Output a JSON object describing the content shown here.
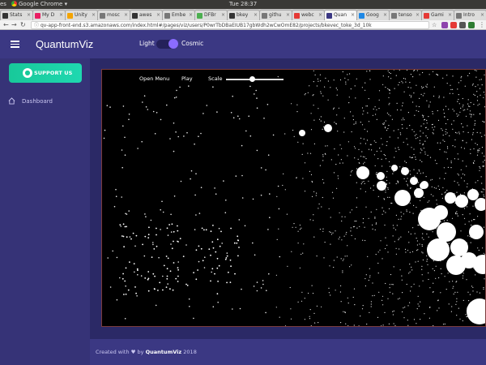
{
  "os": {
    "left_text": "es",
    "app_name": "Google Chrome",
    "clock": "Tue 28:37"
  },
  "tabs": [
    {
      "label": "Stats",
      "color": "#333"
    },
    {
      "label": "My D",
      "color": "#e91e63"
    },
    {
      "label": "Unity",
      "color": "#f4a400"
    },
    {
      "label": "mosc",
      "color": "#777"
    },
    {
      "label": "awes",
      "color": "#333"
    },
    {
      "label": "Embe",
      "color": "#777"
    },
    {
      "label": "DFBr",
      "color": "#4caf50"
    },
    {
      "label": "bkey",
      "color": "#333"
    },
    {
      "label": "githu",
      "color": "#777"
    },
    {
      "label": "webc",
      "color": "#e53935"
    },
    {
      "label": "Quan",
      "color": "#3b3883"
    },
    {
      "label": "Goog",
      "color": "#1e88e5"
    },
    {
      "label": "tenso",
      "color": "#777"
    },
    {
      "label": "Gami",
      "color": "#e53935"
    },
    {
      "label": "Intro",
      "color": "#777"
    }
  ],
  "browser": {
    "url": "qv-app-front-end.s3.amazonaws.com/index.html#/pages/viz/users/P0wrTbDBaEIUB17gbWdh2wCwOmE82/projects/bkevec_toke_3d_10k"
  },
  "header": {
    "brand": "QuantumViz",
    "toggle_light": "Light",
    "toggle_cosmic": "Cosmic"
  },
  "sidebar": {
    "support_label": "SUPPORT US",
    "items": [
      {
        "label": "Dashboard"
      }
    ]
  },
  "viz": {
    "open_menu": "Open Menu",
    "play": "Play",
    "scale": "Scale",
    "scale_value": 0.45
  },
  "footer": {
    "prefix": "Created with ♥ by",
    "brand": "QuantumViz",
    "year": "2018"
  },
  "colors": {
    "header_bg": "#3b3883",
    "sidebar_bg": "#363377",
    "accent_green": "#18c99a",
    "toggle_knob": "#8a6cff"
  }
}
